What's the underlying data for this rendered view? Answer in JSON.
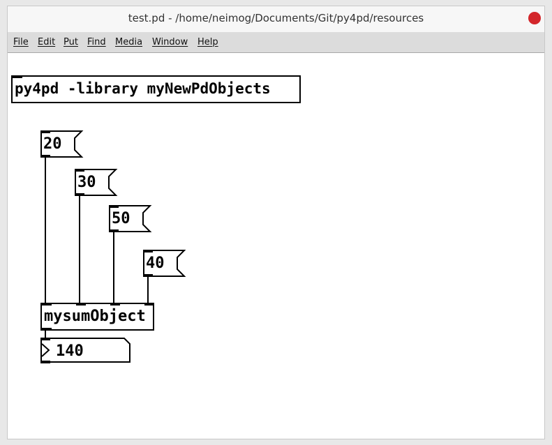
{
  "window": {
    "title": "test.pd  - /home/neimog/Documents/Git/py4pd/resources"
  },
  "menu": {
    "items": [
      "File",
      "Edit",
      "Put",
      "Find",
      "Media",
      "Window",
      "Help"
    ]
  },
  "patch": {
    "library_object": "py4pd -library myNewPdObjects",
    "messages": [
      "20",
      "30",
      "50",
      "40"
    ],
    "sum_object": "mysumObject",
    "result_number": "140"
  },
  "colors": {
    "close_button": "#d3262b",
    "menubar": "#dcdcdc",
    "canvas": "#ffffff",
    "ink": "#000000"
  }
}
